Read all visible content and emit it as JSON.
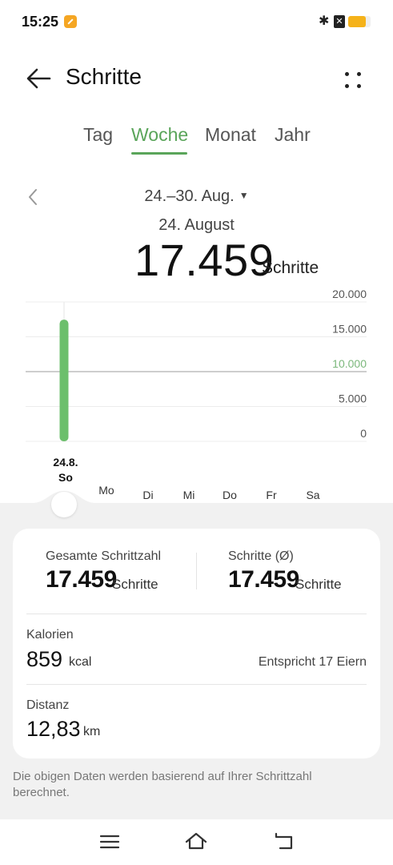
{
  "status": {
    "time": "15:25",
    "battery_level": 0.8,
    "icons": [
      "app-notification-icon",
      "bluetooth-icon",
      "sim-off-icon",
      "battery-icon"
    ]
  },
  "header": {
    "title": "Schritte"
  },
  "tabs": [
    {
      "label": "Tag",
      "active": false
    },
    {
      "label": "Woche",
      "active": true
    },
    {
      "label": "Monat",
      "active": false
    },
    {
      "label": "Jahr",
      "active": false
    }
  ],
  "period": {
    "range": "24.–30. Aug.",
    "selected_date": "24. August",
    "value": "17.459",
    "unit": "Schritte"
  },
  "chart_data": {
    "type": "bar",
    "categories": [
      "24.8. So",
      "Mo",
      "Di",
      "Mi",
      "Do",
      "Fr",
      "Sa"
    ],
    "values": [
      17459,
      null,
      null,
      null,
      null,
      null,
      null
    ],
    "ylim": [
      0,
      20000
    ],
    "y_ticks": [
      "20.000",
      "15.000",
      "10.000",
      "5.000",
      "0"
    ],
    "goal": 10000,
    "selected_index": 0,
    "bar_color": "#6cbf6c",
    "goal_color": "#7cb87c"
  },
  "day_labels": {
    "selected_date": "24.8.",
    "selected_day": "So",
    "others": [
      "Mo",
      "Di",
      "Mi",
      "Do",
      "Fr",
      "Sa"
    ]
  },
  "summary": {
    "total_label": "Gesamte Schrittzahl",
    "total_value": "17.459",
    "total_unit": "Schritte",
    "avg_label": "Schritte (Ø)",
    "avg_value": "17.459",
    "avg_unit": "Schritte",
    "calories_label": "Kalorien",
    "calories_value": "859",
    "calories_unit": "kcal",
    "calories_equiv": "Entspricht 17 Eiern",
    "distance_label": "Distanz",
    "distance_value": "12,83",
    "distance_unit": "km"
  },
  "footnote": "Die obigen Daten werden basierend auf Ihrer Schrittzahl berechnet.",
  "colors": {
    "accent": "#5aa55a",
    "background": "#f1f1f1"
  }
}
